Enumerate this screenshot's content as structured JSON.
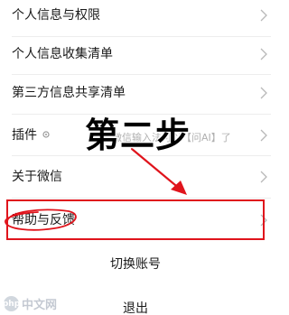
{
  "menu": {
    "items": [
      {
        "label": "个人信息与权限"
      },
      {
        "label": "个人信息收集清单"
      },
      {
        "label": "第三方信息共享清单"
      },
      {
        "label": "插件",
        "hint": "微信输入法可以【问AI】了"
      },
      {
        "label": "关于微信"
      },
      {
        "label": "帮助与反馈"
      }
    ]
  },
  "actions": {
    "switch_account": "切换账号",
    "logout": "退出"
  },
  "overlay": {
    "step_text": "第二步",
    "accent_color": "#e0141c"
  },
  "watermark": {
    "badge": "php",
    "text": "中文网"
  }
}
